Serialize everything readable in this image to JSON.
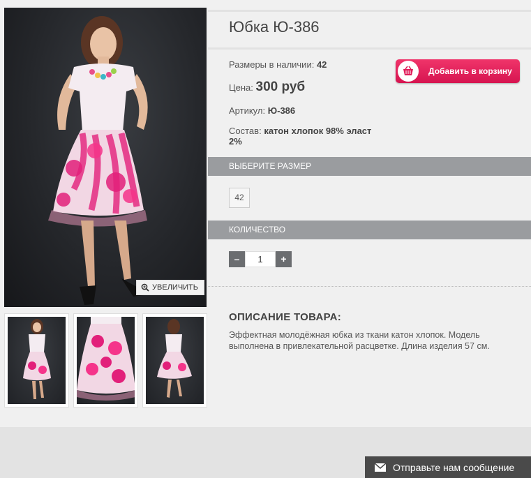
{
  "product": {
    "title": "Юбка Ю-386",
    "sizes_label": "Размеры в наличии:",
    "sizes_value": "42",
    "price_label": "Цена:",
    "price_value": "300 руб",
    "sku_label": "Артикул:",
    "sku_value": "Ю-386",
    "composition_label": "Состав:",
    "composition_value": "катон хлопок 98% эласт 2%"
  },
  "cart_button": {
    "label": "Добавить в корзину",
    "icon": "basket-icon"
  },
  "gallery": {
    "zoom_label": "УВЕЛИЧИТЬ",
    "zoom_icon": "magnifier-icon"
  },
  "size_section": {
    "header": "ВЫБЕРИТЕ РАЗМЕР",
    "options": [
      "42"
    ]
  },
  "quantity_section": {
    "header": "КОЛИЧЕСТВО",
    "minus": "–",
    "value": "1",
    "plus": "+"
  },
  "description": {
    "title": "ОПИСАНИЕ ТОВАРА:",
    "text": "Эффектная молодёжная юбка из ткани катон хлопок. Модель выполнена в привлекательной расцветке. Длина изделия 57 см."
  },
  "message_button": {
    "label": "Отправьте нам сообщение",
    "icon": "envelope-icon"
  },
  "colors": {
    "accent": "#e01d5a",
    "bar": "#9a9c9f",
    "dark": "#4a4a4a"
  }
}
